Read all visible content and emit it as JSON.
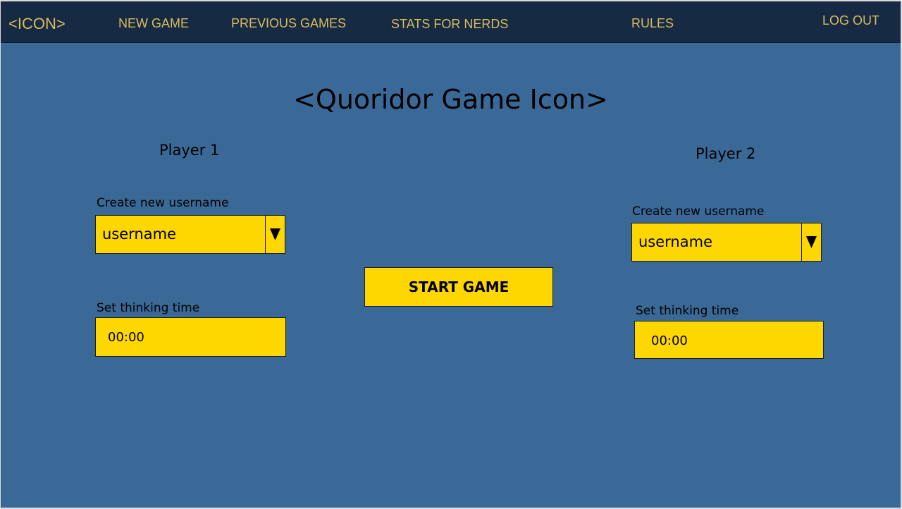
{
  "nav": {
    "logo": "<ICON>",
    "new_game": "NEW GAME",
    "previous_games": "PREVIOUS GAMES",
    "stats": "STATS FOR NERDS",
    "rules": "RULES",
    "logout": "LOG OUT"
  },
  "title": "<Quoridor Game Icon>",
  "player1": {
    "title": "Player 1",
    "username_label": "Create new username",
    "username_value": "username",
    "time_label": "Set thinking time",
    "time_value": "00:00"
  },
  "player2": {
    "title": "Player 2",
    "username_label": "Create new username",
    "username_value": "username",
    "time_label": "Set thinking time",
    "time_value": "00:00"
  },
  "start_button": "START GAME",
  "colors": {
    "background": "#3b6997",
    "navbar": "#172a43",
    "nav_text": "#d9bd5f",
    "field_fill": "#ffd700"
  },
  "icons": {
    "dropdown": "triangle-down-icon"
  }
}
